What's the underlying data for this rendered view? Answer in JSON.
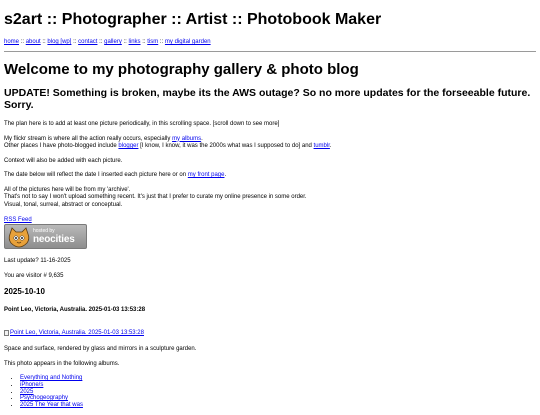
{
  "site": {
    "title": "s2art :: Photographer :: Artist :: Photobook Maker"
  },
  "nav": {
    "links": [
      "home",
      "about",
      "blog [wp]",
      "contact",
      "gallery",
      "links",
      "tism",
      "my digital garden"
    ],
    "separator": "::"
  },
  "main": {
    "heading": "Welcome to my photography gallery & photo blog",
    "update": "UPDATE! Something is broken, maybe its the AWS outage? So no more updates for the forseeable future. Sorry.",
    "intro": "The plan here is to add at least one picture periodically, in this scrolling space. [scroll down to see more]",
    "flickr_line1_prefix": "My flickr stream is where all the action really occurs, especially ",
    "flickr_albums_link": "my albums",
    "flickr_line1_suffix": ".",
    "flickr_line2_prefix": "Other places I have photo-blogged include ",
    "blogger_link": "blogger",
    "flickr_line2_middle": " [I know, I know, it was the 2000s what was I supposed to do] and ",
    "tumblr_link": "tumblr",
    "flickr_line2_suffix": ".",
    "context": "Context will also be added with each picture.",
    "date_prefix": "The date below will reflect the date I inserted each picture here or on ",
    "front_page_link": "my front page",
    "date_suffix": ".",
    "archive_line1": "All of the pictures here will be from my 'archive'.",
    "archive_line2": "That's not to say I won't upload something recent.  It's just that I prefer to curate my online presence in some order.",
    "archive_line3": "Visual, tonal, surreal, abstract or conceptual.",
    "rss": "RSS Feed",
    "badge_small": "hosted by",
    "badge_big": "neocities",
    "last_update": "Last update? 11-16-2025",
    "visitor": "You are visitor # 9,635"
  },
  "post": {
    "date": "2025-10-10",
    "title": "Point Leo, Victoria, Australia. 2025-01-03 13:53:28",
    "image_alt": "Point Leo, Victoria, Australia. 2025-01-03 13:53:28",
    "description": "Space and surface, rendered by glass and mirrors in a sculpture garden.",
    "albums_intro": "This photo appears in the following albums.",
    "albums": [
      "Everything and Nothing",
      "iPhone/s",
      "2025",
      "Psychogeography",
      "2025 The Year that was"
    ]
  },
  "colors": {
    "link": "#0000ee",
    "divider": "#9a9a9a",
    "badge_bg": "#a0a0a0",
    "cat_orange": "#e8a13a"
  },
  "icons": {
    "badge": "neocities-cat-icon",
    "broken_image": "broken-image-icon"
  }
}
